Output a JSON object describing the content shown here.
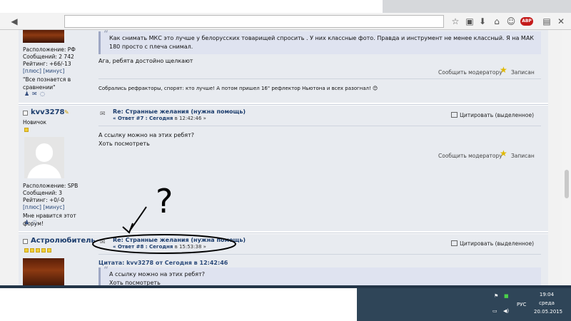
{
  "posts": {
    "p1": {
      "sidebar": {
        "location": "Расположение: РФ",
        "messages": "Сообщений: 2 742",
        "rating": "Рейтинг: +66/-13",
        "plus": "[плюс]",
        "minus": "[минус]",
        "signature": "\"Все познается в сравнении\""
      },
      "quote_text": "Как снимать МКС это лучше у белорусских товарищей спросить . У них классные фото. Правда и инструмент не менее классный. Я на МАК 180 просто с плеча снимал.",
      "reply_text": "Ага, ребята достойно щелкают",
      "report": "Сообщить модератору",
      "note_label": "Записан",
      "signature_line": "Собрались рефракторы, спорят: кто лучше! А потом пришел 16\" рефлектор Ньютона и всех разогнал! 😊"
    },
    "p2": {
      "username": "kvv3278",
      "rank": "Новичок",
      "sidebar": {
        "location": "Расположение: SPB",
        "messages": "Сообщений: 3",
        "rating": "Рейтинг: +0/-0",
        "plus": "[плюс]",
        "minus": "[минус]",
        "signature": "Мне нравится этот форум!"
      },
      "title": "Re: Странные желания (нужна помощь)",
      "sub_prefix": "« Ответ #7 : Сегодня",
      "sub_time": " в 12:42:46 »",
      "cite": "Цитировать (выделенное)",
      "body_line1": "А ссылку можно на этих ребят?",
      "body_line2": "Хоть посмотреть",
      "report": "Сообщить модератору",
      "note_label": "Записан"
    },
    "p3": {
      "username": "Астролюбитель",
      "title": "Re: Странные желания (нужна помощь)",
      "sub_prefix": "« Ответ #8 : Сегодня",
      "sub_time": " в 15:53:38 »",
      "cite": "Цитировать (выделенное)",
      "quote_head": "Цитата: kvv3278 от Сегодня в 12:42:46",
      "quote_line1": "А ссылку можно на этих ребят?",
      "quote_line2": "Хоть посмотреть"
    }
  },
  "taskbar": {
    "lang": "РУС",
    "time": "19:04",
    "day": "среда",
    "date": "20.05.2015"
  },
  "annotation": {
    "question_mark": "?"
  },
  "icons": [
    "back-icon",
    "star-icon",
    "bookmarks-icon",
    "download-icon",
    "home-icon",
    "chat-icon",
    "adblock-icon",
    "menu-icon",
    "close-icon"
  ]
}
